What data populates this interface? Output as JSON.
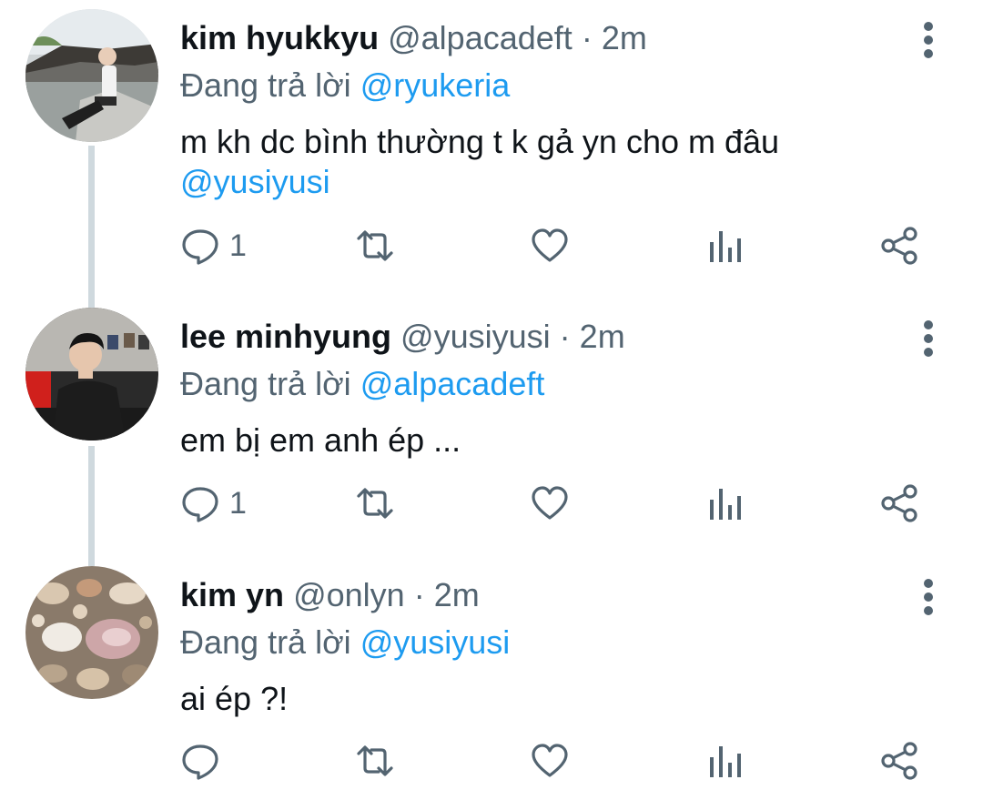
{
  "reply_prefix": "Đang trả lời",
  "tweets": [
    {
      "name": "kim hyukkyu",
      "handle": "@alpacadeft",
      "separator": "·",
      "time": "2m",
      "reply_to": "@ryukeria",
      "text": "m kh dc bình thường t k gả yn cho m đâu",
      "text_mention": "@yusiyusi",
      "reply_count": "1",
      "avatar_icon": "profile-photo-outdoor"
    },
    {
      "name": "lee minhyung",
      "handle": "@yusiyusi",
      "separator": "·",
      "time": "2m",
      "reply_to": "@alpacadeft",
      "text": "em bị em anh ép ...",
      "reply_count": "1",
      "avatar_icon": "profile-photo-indoor"
    },
    {
      "name": "kim yn",
      "handle": "@onlyn",
      "separator": "·",
      "time": "2m",
      "reply_to": "@yusiyusi",
      "text": "ai ép ?!",
      "reply_count": "",
      "avatar_icon": "profile-photo-seashells"
    }
  ],
  "colors": {
    "primary_text": "#0f1419",
    "secondary_text": "#536471",
    "link": "#1d9bf0",
    "thread_line": "#cfd9de"
  }
}
